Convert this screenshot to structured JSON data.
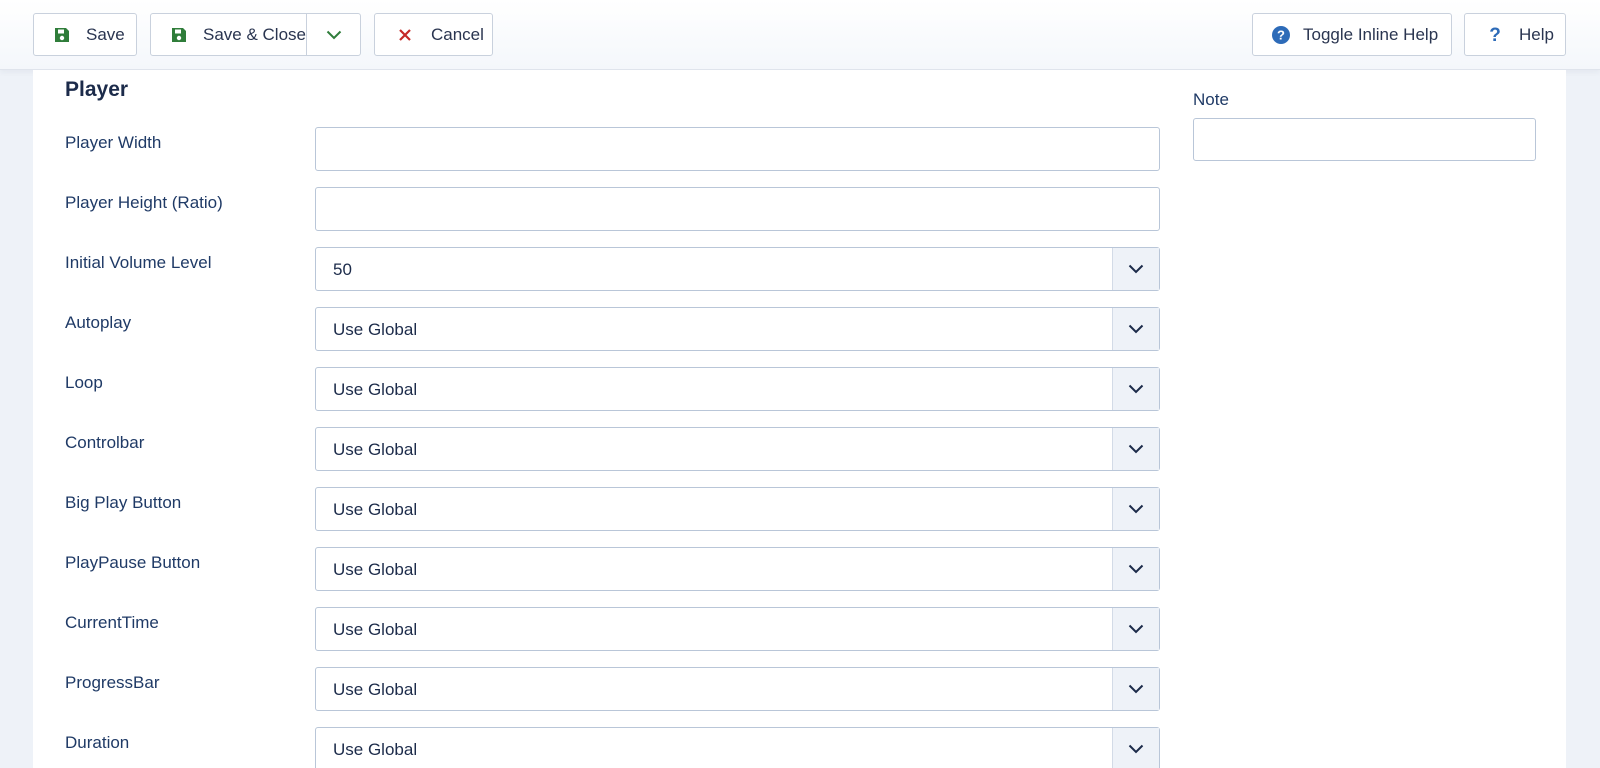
{
  "toolbar": {
    "save_label": "Save",
    "save_close_label": "Save & Close",
    "cancel_label": "Cancel",
    "toggle_help_label": "Toggle Inline Help",
    "help_label": "Help"
  },
  "colors": {
    "save_icon": "#2f7d3a",
    "cancel_icon": "#c52827",
    "help_icon": "#2d6bb8",
    "label_text": "#1f3a66"
  },
  "section": {
    "title": "Player"
  },
  "fields": [
    {
      "label": "Player Width",
      "type": "text",
      "value": ""
    },
    {
      "label": "Player Height (Ratio)",
      "type": "text",
      "value": ""
    },
    {
      "label": "Initial Volume Level",
      "type": "select",
      "value": "50"
    },
    {
      "label": "Autoplay",
      "type": "select",
      "value": "Use Global"
    },
    {
      "label": "Loop",
      "type": "select",
      "value": "Use Global"
    },
    {
      "label": "Controlbar",
      "type": "select",
      "value": "Use Global"
    },
    {
      "label": "Big Play Button",
      "type": "select",
      "value": "Use Global"
    },
    {
      "label": "PlayPause Button",
      "type": "select",
      "value": "Use Global"
    },
    {
      "label": "CurrentTime",
      "type": "select",
      "value": "Use Global"
    },
    {
      "label": "ProgressBar",
      "type": "select",
      "value": "Use Global"
    },
    {
      "label": "Duration",
      "type": "select",
      "value": "Use Global"
    }
  ],
  "note": {
    "label": "Note",
    "value": ""
  }
}
